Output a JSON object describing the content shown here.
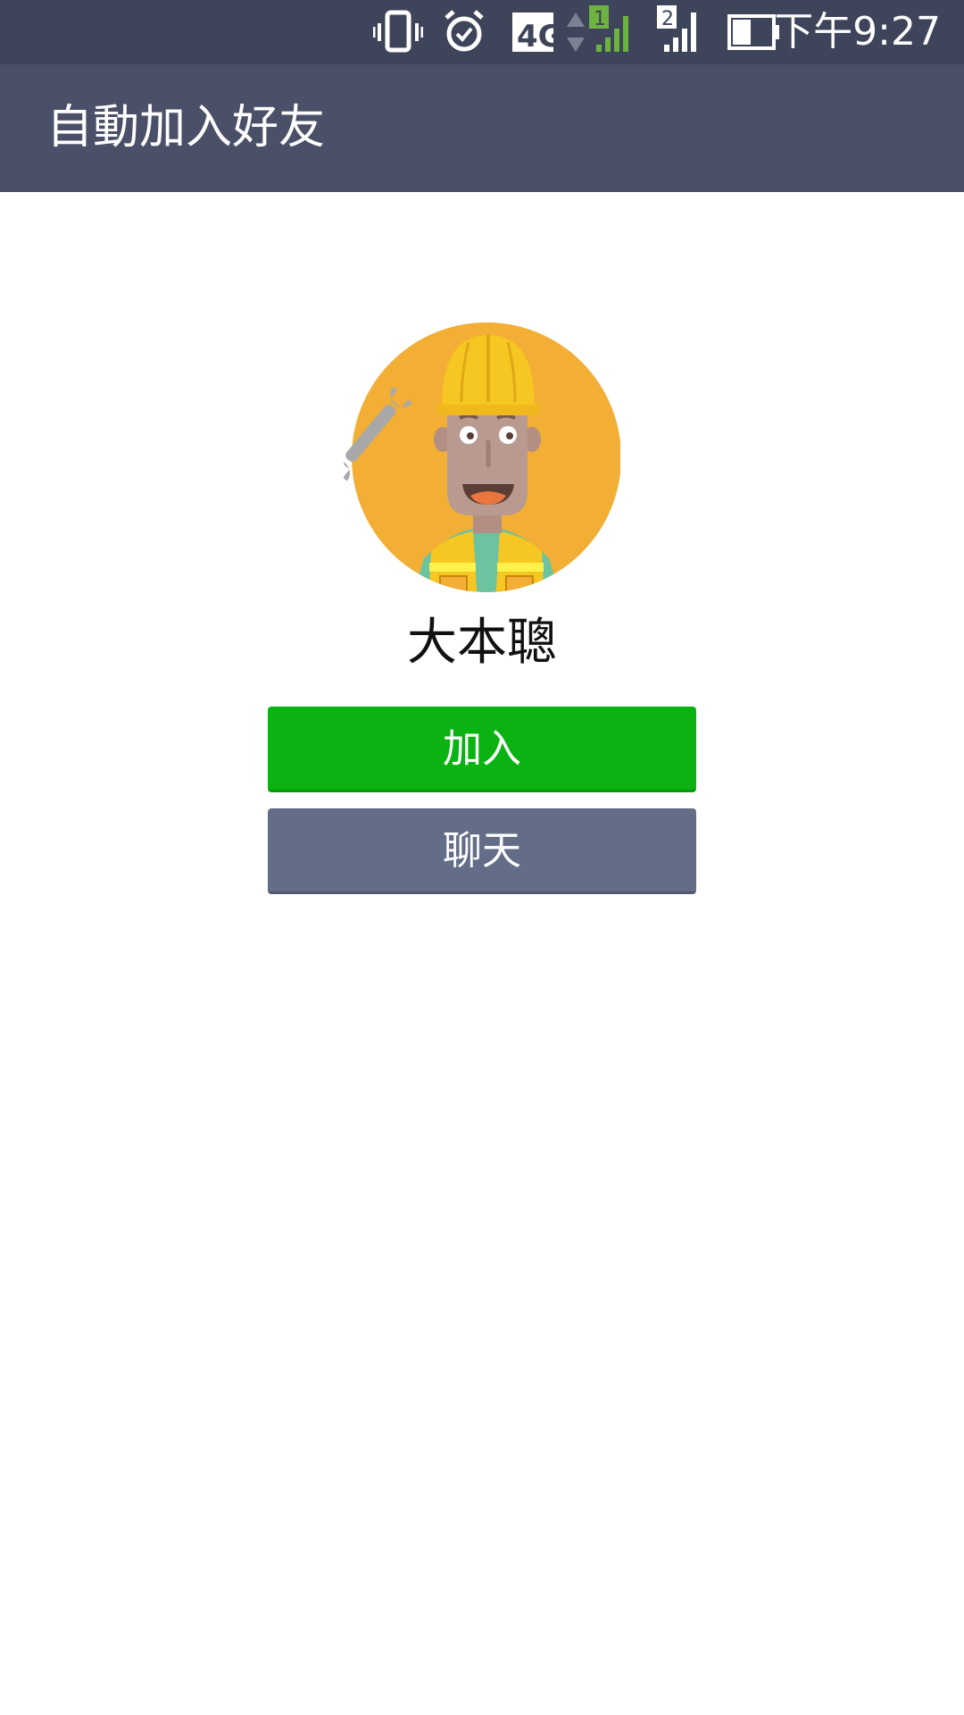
{
  "status_bar": {
    "time": "下午9:27",
    "icons": [
      "vibrate-icon",
      "alarm-icon",
      "4g-plus-icon",
      "data-arrows-icon",
      "signal-sim1-icon",
      "signal-sim2-icon",
      "battery-icon"
    ],
    "network_label": "4G",
    "sim1_label": "1",
    "sim2_label": "2"
  },
  "header": {
    "title": "自動加入好友"
  },
  "profile": {
    "name": "大本聰",
    "avatar": "worker-avatar-illustration"
  },
  "actions": {
    "add_label": "加入",
    "chat_label": "聊天"
  },
  "colors": {
    "status_bar_bg": "#3e4459",
    "app_bar_bg": "#4a5068",
    "add_button": "#0ab212",
    "chat_button": "#636d87",
    "avatar_bg": "#f2ae35"
  }
}
